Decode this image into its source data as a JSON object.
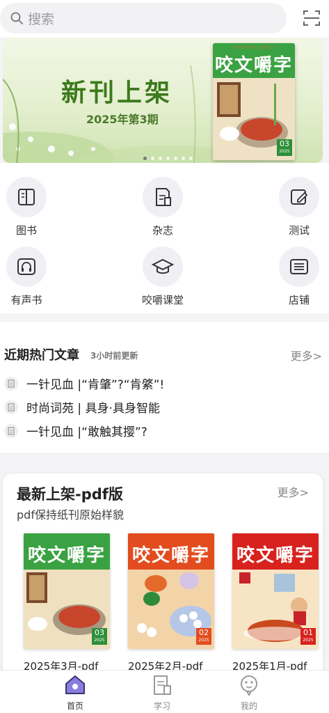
{
  "search": {
    "placeholder": "搜索"
  },
  "banner": {
    "title": "新刊上架",
    "subtitle": "2025年第3期"
  },
  "quick": [
    {
      "label": "图书",
      "icon": "book-icon"
    },
    {
      "label": "杂志",
      "icon": "magazine-icon"
    },
    {
      "label": "测试",
      "icon": "test-icon"
    },
    {
      "label": "有声书",
      "icon": "headphones-icon"
    },
    {
      "label": "咬嚼课堂",
      "icon": "graduation-cap-icon"
    },
    {
      "label": "店铺",
      "icon": "store-icon"
    }
  ],
  "hot": {
    "title": "近期热门文章",
    "updated": "3小时前更新",
    "more": "更多>",
    "articles": [
      "一针见血 |“肯肇”?“肯綮”!",
      "时尚词苑 | 具身·具身智能",
      "一针见血 |“敢触其撄”?"
    ]
  },
  "pdf": {
    "title": "最新上架-pdf版",
    "subtitle": "pdf保持纸刊原始样貌",
    "more": "更多>",
    "magazines": [
      {
        "label": "2025年3月-pdf",
        "cover_name": "咬文嚼字",
        "issue": "03",
        "year": "2025",
        "color": "#3aa242"
      },
      {
        "label": "2025年2月-pdf",
        "cover_name": "咬文嚼字",
        "issue": "02",
        "year": "2025",
        "color": "#e24c1f"
      },
      {
        "label": "2025年1月-pdf",
        "cover_name": "咬文嚼字",
        "issue": "01",
        "year": "2025",
        "color": "#d8221e"
      }
    ]
  },
  "banner_cover": {
    "brand": "YAOWEN JIAOZI",
    "name": "咬文嚼字",
    "issue": "03",
    "year": "2025"
  },
  "tabs": [
    {
      "label": "首页",
      "active": true
    },
    {
      "label": "学习",
      "active": false
    },
    {
      "label": "我的",
      "active": false
    }
  ]
}
